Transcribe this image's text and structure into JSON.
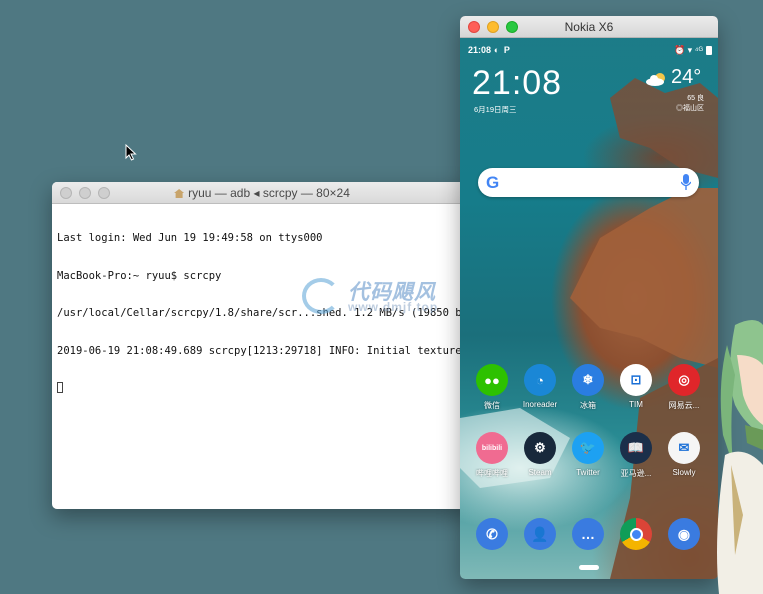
{
  "terminal": {
    "title": "ryuu — adb ◂ scrcpy — 80×24",
    "lines": [
      "Last login: Wed Jun 19 19:49:58 on ttys000",
      "MacBook-Pro:~ ryuu$ scrcpy",
      "/usr/local/Cellar/scrcpy/1.8/share/scr...shed. 1.2 MB/s (19850 by",
      "2019-06-19 21:08:49.689 scrcpy[1213:29718] INFO: Initial texture:"
    ]
  },
  "watermark": {
    "brand": "代码飓风",
    "url": "www.dmjf.top"
  },
  "phone": {
    "window_title": "Nokia X6",
    "status": {
      "time": "21:08",
      "notifications": "◐ P",
      "right_icons": "⏰ ▾ ⁴ᴳ"
    },
    "clock": "21:08",
    "date": "6月19日周三",
    "weather": {
      "temp": "24°",
      "aqi": "65 良",
      "location": "◎福山区"
    },
    "search": {
      "g": "G"
    },
    "apps": [
      {
        "label": "微信",
        "color": "#2dc100",
        "icon": "wechat-icon",
        "glyph": "●●"
      },
      {
        "label": "Inoreader",
        "color": "#1a87d6",
        "icon": "inoreader-icon",
        "glyph": "◔"
      },
      {
        "label": "冰箱",
        "color": "#2a7de1",
        "icon": "fridge-icon",
        "glyph": "❄"
      },
      {
        "label": "TIM",
        "color": "#ffffff",
        "icon": "tim-icon",
        "glyph": "⊡"
      },
      {
        "label": "网易云...",
        "color": "#e0262a",
        "icon": "netease-music-icon",
        "glyph": "◎"
      },
      {
        "label": "哔哩哔哩",
        "color": "#f06b91",
        "icon": "bilibili-icon",
        "glyph": "bilibili"
      },
      {
        "label": "Steam",
        "color": "#18283b",
        "icon": "steam-icon",
        "glyph": "⚙"
      },
      {
        "label": "Twitter",
        "color": "#1da1f2",
        "icon": "twitter-icon",
        "glyph": "🐦"
      },
      {
        "label": "亚马逊...",
        "color": "#1b2f4a",
        "icon": "kindle-icon",
        "glyph": "📖"
      },
      {
        "label": "Slowly",
        "color": "#f5f5f5",
        "icon": "slowly-icon",
        "glyph": "✉"
      }
    ],
    "dock": [
      {
        "name": "phone",
        "color": "#3a7be0",
        "icon": "phone-icon",
        "glyph": "✆"
      },
      {
        "name": "contacts",
        "color": "#3a7be0",
        "icon": "contacts-icon",
        "glyph": "👤"
      },
      {
        "name": "messages",
        "color": "#3a7be0",
        "icon": "messages-icon",
        "glyph": "…"
      },
      {
        "name": "chrome",
        "color": "#ffffff",
        "icon": "chrome-icon",
        "glyph": ""
      },
      {
        "name": "camera",
        "color": "#3a7be0",
        "icon": "camera-icon",
        "glyph": "◉"
      }
    ]
  }
}
